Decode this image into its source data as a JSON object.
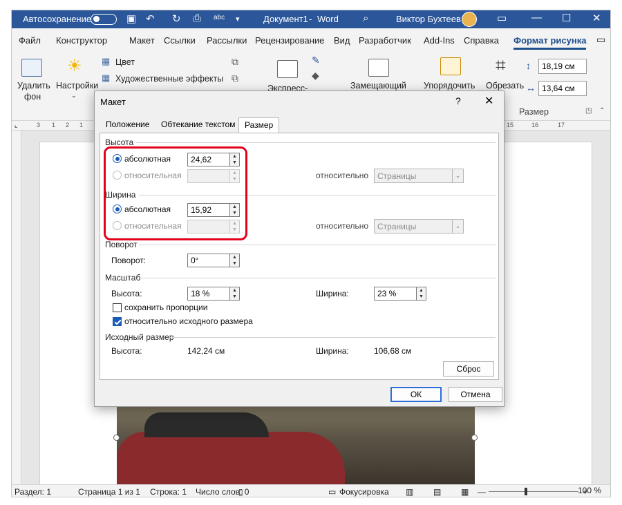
{
  "titlebar": {
    "autosave_label": "Автосохранение",
    "doc_title": "Документ1",
    "app_name": "Word",
    "separator": "-",
    "user_name": "Виктор Бухтеев"
  },
  "menu": [
    "Файл",
    "Конструктор",
    "Макет",
    "Ссылки",
    "Рассылки",
    "Рецензирование",
    "Вид",
    "Разработчик",
    "Add-Ins",
    "Справка",
    "Формат рисунка"
  ],
  "ribbon": {
    "remove_bg": [
      "Удалить",
      "фон"
    ],
    "corrections": "Настройки",
    "color": "Цвет",
    "effects": "Художественные эффекты",
    "express": "Экспресс-",
    "placeholder": "Замещающий",
    "arrange": "Упорядочить",
    "crop": "Обрезать",
    "height_value": "18,19 см",
    "width_value": "13,64 см",
    "size_group": "Размер"
  },
  "ruler_marks": [
    "3",
    "1",
    "2",
    "1",
    "15",
    "16",
    "17"
  ],
  "dialog": {
    "title": "Макет",
    "help": "?",
    "tabs": [
      "Положение",
      "Обтекание текстом",
      "Размер"
    ],
    "active_tab": 2,
    "height": {
      "section": "Высота",
      "absolute_label": "абсолютная",
      "absolute_value": "24,62",
      "relative_label": "относительная",
      "relative_to_label": "относительно",
      "relative_to_value": "Страницы"
    },
    "width": {
      "section": "Ширина",
      "absolute_label": "абсолютная",
      "absolute_value": "15,92",
      "relative_label": "относительная",
      "relative_to_label": "относительно",
      "relative_to_value": "Страницы"
    },
    "rotation": {
      "section": "Поворот",
      "label": "Поворот:",
      "value": "0°"
    },
    "scale": {
      "section": "Масштаб",
      "height_label": "Высота:",
      "height_value": "18 %",
      "width_label": "Ширина:",
      "width_value": "23 %",
      "lock_aspect": "сохранить пропорции",
      "lock_aspect_checked": false,
      "relative_original": "относительно исходного размера",
      "relative_original_checked": true
    },
    "original": {
      "section": "Исходный размер",
      "height_label": "Высота:",
      "height_value": "142,24 см",
      "width_label": "Ширина:",
      "width_value": "106,68 см"
    },
    "reset": "Сброс",
    "ok": "ОК",
    "cancel": "Отмена"
  },
  "statusbar": {
    "section": "Раздел: 1",
    "page": "Страница 1 из 1",
    "line": "Строка: 1",
    "words": "Число слов: 0",
    "focus": "Фокусировка",
    "zoom": "100 %"
  },
  "colors": {
    "titlebar": "#2b579a",
    "accent": "#1e4e8c",
    "highlight": "#e3001b"
  }
}
